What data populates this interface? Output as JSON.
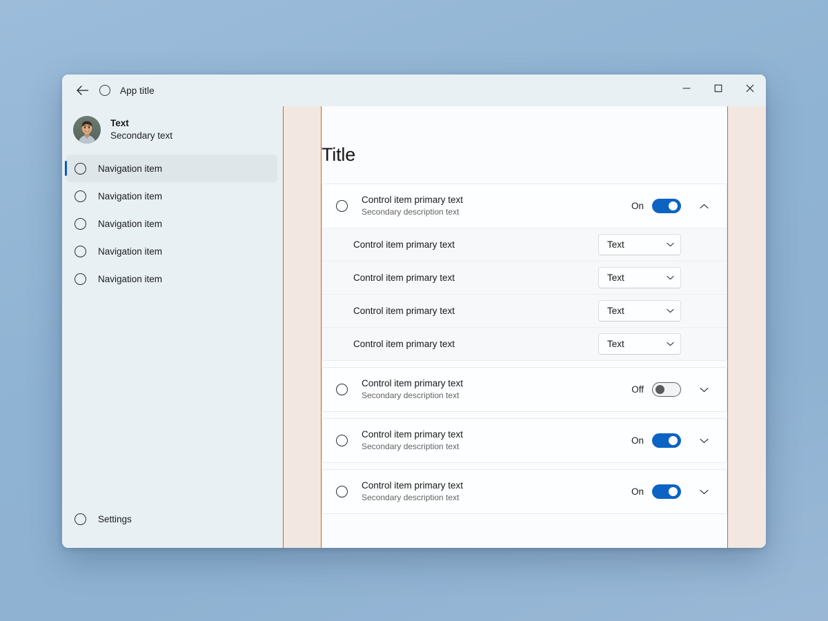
{
  "window": {
    "titlebar": {
      "back_icon": "arrow-left-icon",
      "app_icon": "circle-icon",
      "title": "App title",
      "minimize_label": "minimize-icon",
      "maximize_label": "maximize-icon",
      "close_label": "close-icon"
    }
  },
  "sidebar": {
    "profile": {
      "avatar": "user-avatar-photo",
      "primary": "Text",
      "secondary": "Secondary text"
    },
    "items": [
      {
        "label": "Navigation item",
        "selected": true
      },
      {
        "label": "Navigation item",
        "selected": false
      },
      {
        "label": "Navigation item",
        "selected": false
      },
      {
        "label": "Navigation item",
        "selected": false
      },
      {
        "label": "Navigation item",
        "selected": false
      }
    ],
    "settings": {
      "label": "Settings"
    }
  },
  "content": {
    "title": "Title",
    "cards": [
      {
        "header": {
          "primary": "Control item primary text",
          "secondary": "Secondary description text",
          "toggle_state": "On",
          "toggle_on": true,
          "expanded": true
        },
        "sub_rows": [
          {
            "label": "Control item primary text",
            "value": "Text"
          },
          {
            "label": "Control item primary text",
            "value": "Text"
          },
          {
            "label": "Control item primary text",
            "value": "Text"
          },
          {
            "label": "Control item primary text",
            "value": "Text"
          }
        ]
      },
      {
        "header": {
          "primary": "Control item primary text",
          "secondary": "Secondary description text",
          "toggle_state": "Off",
          "toggle_on": false,
          "expanded": false
        },
        "sub_rows": []
      },
      {
        "header": {
          "primary": "Control item primary text",
          "secondary": "Secondary description text",
          "toggle_state": "On",
          "toggle_on": true,
          "expanded": false
        },
        "sub_rows": []
      },
      {
        "header": {
          "primary": "Control item primary text",
          "secondary": "Secondary description text",
          "toggle_state": "On",
          "toggle_on": true,
          "expanded": false
        },
        "sub_rows": []
      }
    ]
  },
  "colors": {
    "accent": "#0c63c4",
    "selection_indicator": "#0b5cb8",
    "overlay_strip_fill": "#f3e7e1",
    "overlay_strip_border": "#d4661a",
    "sidebar_bg": "#e9f0f4",
    "content_bg": "#fbfcfd",
    "desktop_bg": "#8fb3d3"
  }
}
